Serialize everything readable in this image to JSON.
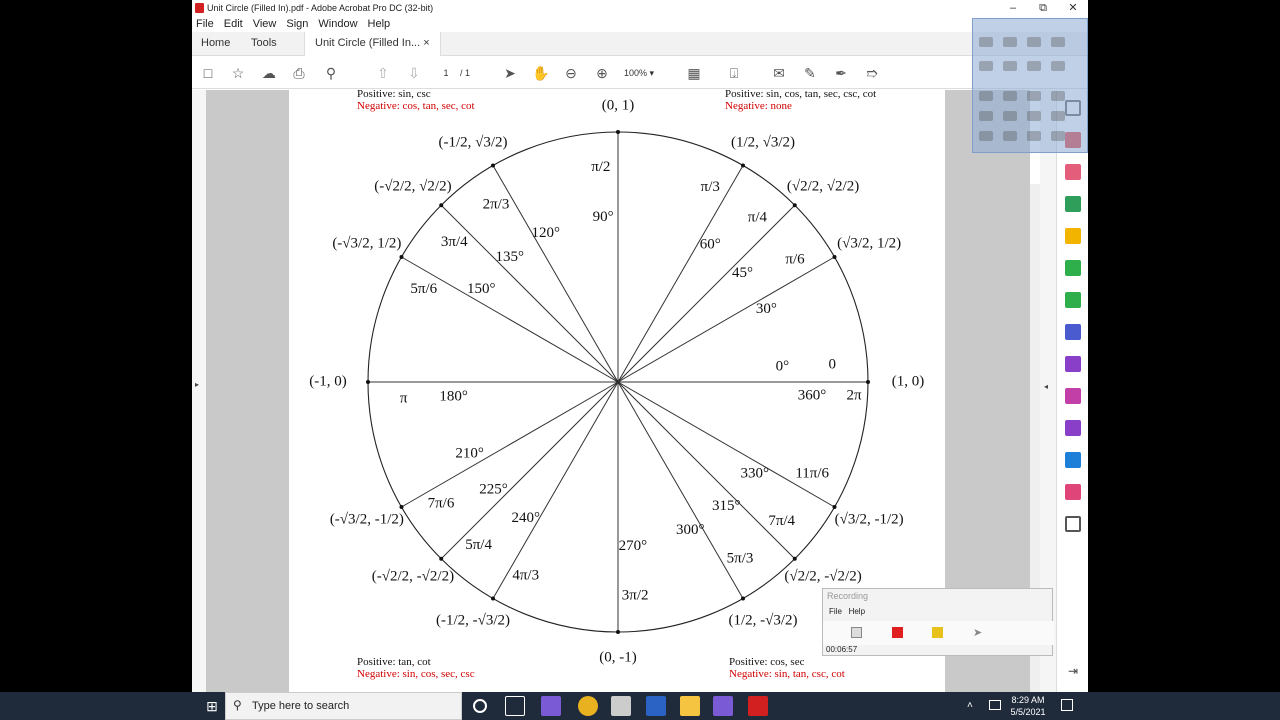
{
  "window": {
    "title": "Unit Circle (Filled In).pdf - Adobe Acrobat Pro DC (32-bit)",
    "buttons": [
      "–",
      "⧉",
      "✕"
    ]
  },
  "menu": [
    "File",
    "Edit",
    "View",
    "Sign",
    "Window",
    "Help"
  ],
  "tabs": {
    "home": "Home",
    "tools": "Tools",
    "doc": "Unit Circle (Filled In...",
    "close": "×"
  },
  "toolbar": {
    "page_current": "1",
    "page_total": "/ 1",
    "zoom": "100%"
  },
  "quadrants": {
    "q1": {
      "pos": "Positive: sin, cos, tan, sec, csc, cot",
      "neg": "Negative: none"
    },
    "q2": {
      "pos": "Positive: sin, csc",
      "neg": "Negative: cos, tan, sec, cot"
    },
    "q3": {
      "pos": "Positive: tan, cot",
      "neg": "Negative: sin, cos, sec, csc"
    },
    "q4": {
      "pos": "Positive: cos, sec",
      "neg": "Negative: sin, tan, csc, cot"
    }
  },
  "angles": [
    {
      "deg": "0°",
      "rad": "0",
      "rad2": "2π",
      "deg2": "360°",
      "point": "(1, 0)"
    },
    {
      "deg": "30°",
      "rad": "π/6",
      "point": "(√3/2, 1/2)"
    },
    {
      "deg": "45°",
      "rad": "π/4",
      "point": "(√2/2, √2/2)"
    },
    {
      "deg": "60°",
      "rad": "π/3",
      "point": "(1/2, √3/2)"
    },
    {
      "deg": "90°",
      "rad": "π/2",
      "point": "(0, 1)"
    },
    {
      "deg": "120°",
      "rad": "2π/3",
      "point": "(-1/2, √3/2)"
    },
    {
      "deg": "135°",
      "rad": "3π/4",
      "point": "(-√2/2, √2/2)"
    },
    {
      "deg": "150°",
      "rad": "5π/6",
      "point": "(-√3/2, 1/2)"
    },
    {
      "deg": "180°",
      "rad": "π",
      "point": "(-1, 0)"
    },
    {
      "deg": "210°",
      "rad": "7π/6",
      "point": "(-√3/2, -1/2)"
    },
    {
      "deg": "225°",
      "rad": "5π/4",
      "point": "(-√2/2, -√2/2)"
    },
    {
      "deg": "240°",
      "rad": "4π/3",
      "point": "(-1/2, -√3/2)"
    },
    {
      "deg": "270°",
      "rad": "3π/2",
      "point": "(0, -1)"
    },
    {
      "deg": "300°",
      "rad": "5π/3",
      "point": "(1/2, -√3/2)"
    },
    {
      "deg": "315°",
      "rad": "7π/4",
      "point": "(√2/2, -√2/2)"
    },
    {
      "deg": "330°",
      "rad": "11π/6",
      "point": "(√3/2, -1/2)"
    }
  ],
  "recording": {
    "title": "Recording",
    "menu": [
      "File",
      "Help"
    ],
    "time": "00:06:57"
  },
  "taskbar": {
    "search_placeholder": "Type here to search",
    "time": "8:29 AM",
    "date": "5/5/2021"
  }
}
